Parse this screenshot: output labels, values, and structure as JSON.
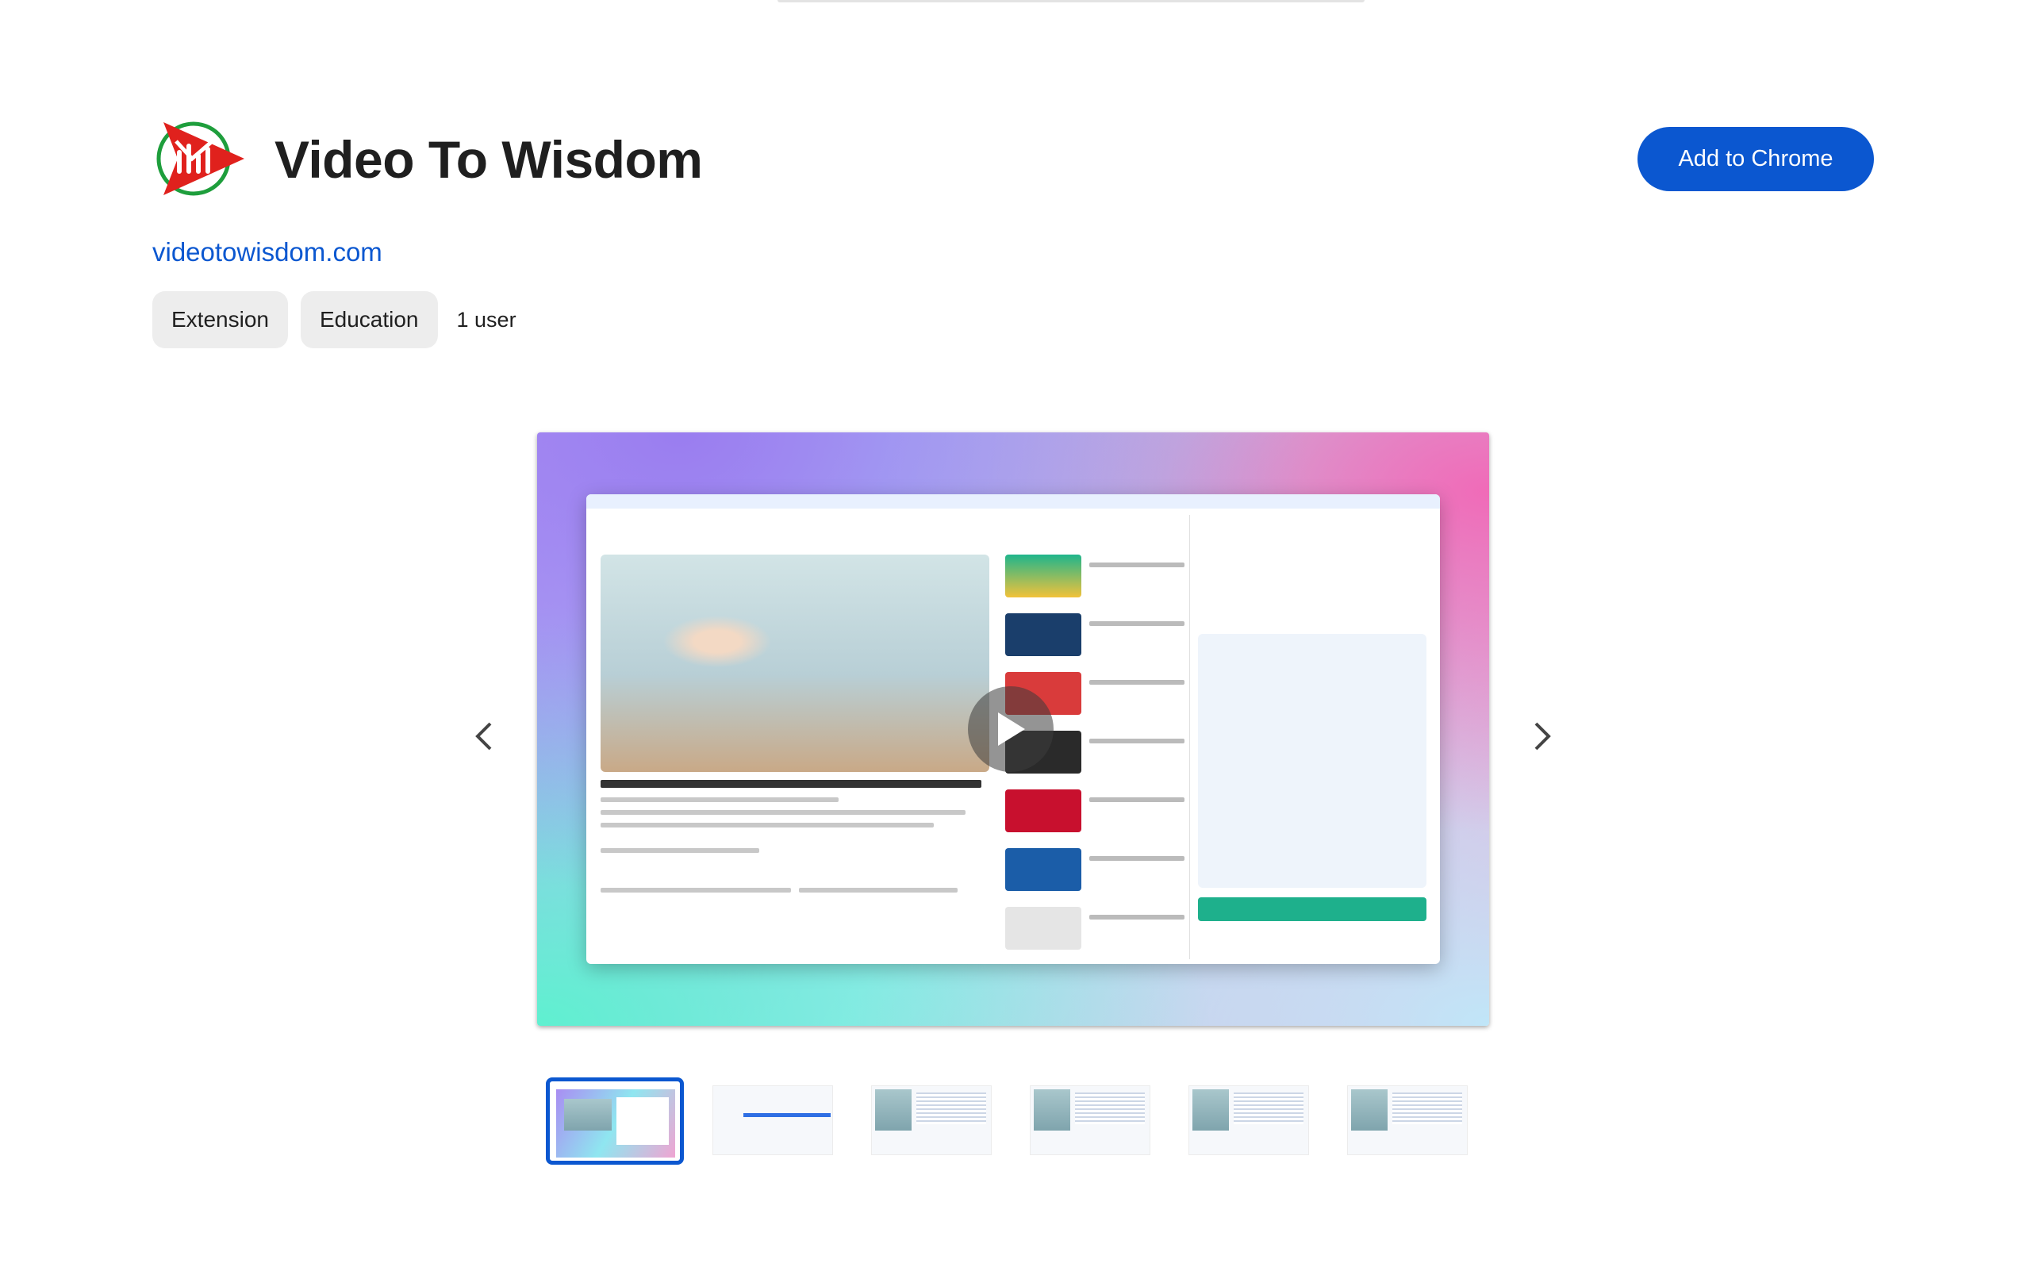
{
  "extension": {
    "name": "Video To Wisdom",
    "website": "videotowisdom.com",
    "add_button_label": "Add to Chrome",
    "chips": [
      "Extension",
      "Education"
    ],
    "users": "1 user"
  },
  "carousel": {
    "thumbnail_count": 6,
    "active_index": 0
  },
  "colors": {
    "primary": "#0b57d0",
    "logo_red": "#e0211d",
    "logo_green": "#1e9e3c"
  },
  "icons": {
    "prev": "chevron-left-icon",
    "next": "chevron-right-icon",
    "play": "play-icon"
  }
}
